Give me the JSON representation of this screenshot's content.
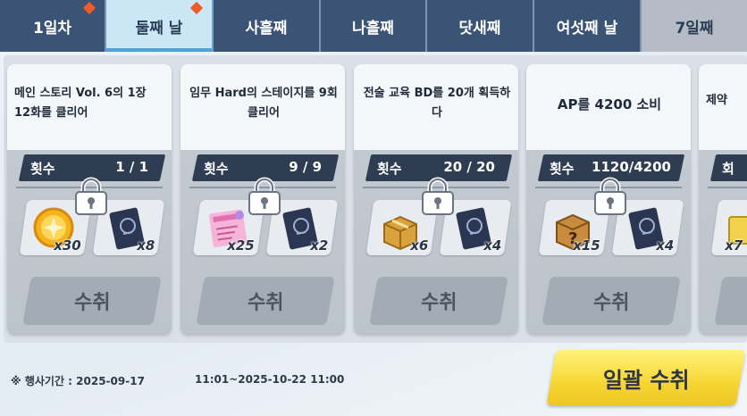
{
  "tabs": [
    {
      "label": "1일차",
      "badge": true,
      "state": "normal"
    },
    {
      "label": "둘째 날",
      "badge": true,
      "state": "active"
    },
    {
      "label": "사흘째",
      "badge": false,
      "state": "normal"
    },
    {
      "label": "나흘째",
      "badge": false,
      "state": "normal"
    },
    {
      "label": "닷새째",
      "badge": false,
      "state": "normal"
    },
    {
      "label": "여섯째 날",
      "badge": false,
      "state": "normal"
    },
    {
      "label": "7일째",
      "badge": false,
      "state": "locked"
    }
  ],
  "missions": [
    {
      "title": "메인 스토리 Vol. 6의 1장 12화를 클리어",
      "count_label": "횟수",
      "count_value": "1 / 1",
      "rewards": [
        {
          "icon": "gold-coin-icon",
          "qty": "x30"
        },
        {
          "icon": "blue-book-icon",
          "qty": "x8"
        }
      ],
      "claim_label": "수취",
      "locked": true
    },
    {
      "title": "임무 Hard의 스테이지를 9회 클리어",
      "count_label": "횟수",
      "count_value": "9 / 9",
      "rewards": [
        {
          "icon": "pink-report-icon",
          "qty": "x25"
        },
        {
          "icon": "blue-book-icon",
          "qty": "x2"
        }
      ],
      "claim_label": "수취",
      "locked": true
    },
    {
      "title": "전술 교육 BD를 20개 획득하다",
      "count_label": "횟수",
      "count_value": "20 / 20",
      "rewards": [
        {
          "icon": "gold-box-icon",
          "qty": "x6"
        },
        {
          "icon": "blue-book-icon",
          "qty": "x4"
        }
      ],
      "claim_label": "수취",
      "locked": true
    },
    {
      "title": "AP를 4200 소비",
      "count_label": "횟수",
      "count_value": "1120/4200",
      "rewards": [
        {
          "icon": "mystery-box-icon",
          "qty": "x15"
        },
        {
          "icon": "blue-book-icon",
          "qty": "x4"
        }
      ],
      "claim_label": "수취",
      "locked": true
    },
    {
      "title": "제약",
      "count_label": "회",
      "reward_qty": "x7"
    }
  ],
  "footer": {
    "period_label": "※ 행사기간 : 2025-09-17",
    "period_end": "11:01~2025-10-22 11:00",
    "bulk_claim_label": "일괄 수취"
  },
  "colors": {
    "tab_dark": "#3b5374",
    "tab_active": "#cbe7f6",
    "badge": "#f05a24",
    "count_bar": "#2f3d52",
    "bulk_button": "#f6d634"
  }
}
